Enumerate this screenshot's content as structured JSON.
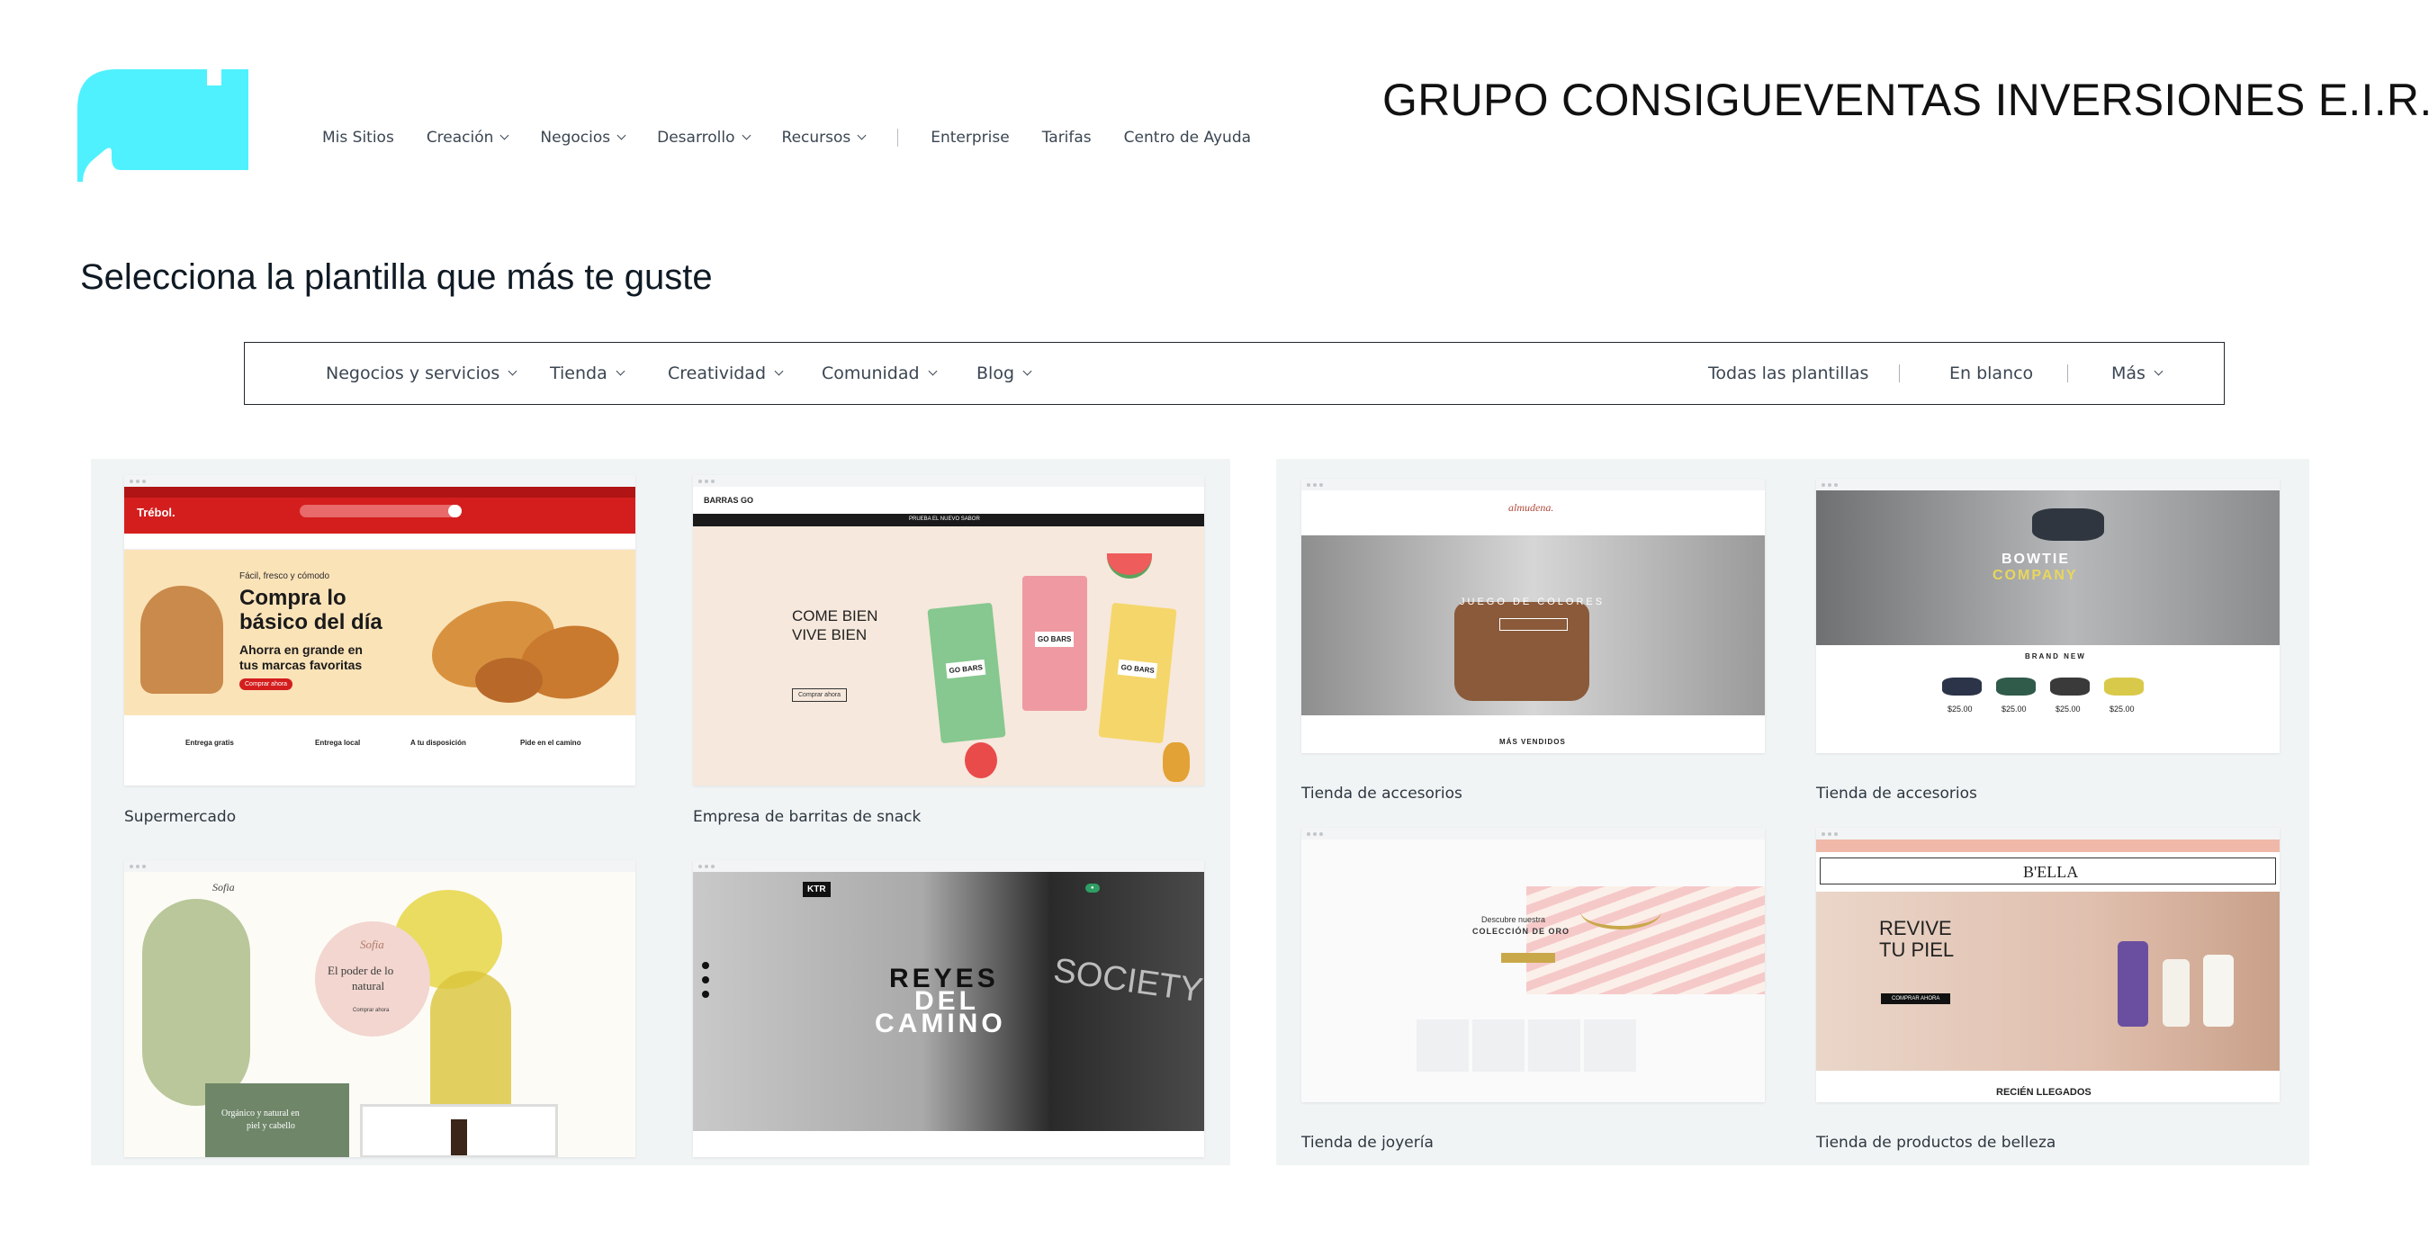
{
  "brand": {
    "company_name": "GRUPO CONSIGUEVENTAS INVERSIONES E.I.R.L.",
    "logo_color": "#4ff1ff"
  },
  "nav": {
    "items": [
      {
        "label": "Mis Sitios",
        "dropdown": false
      },
      {
        "label": "Creación",
        "dropdown": true
      },
      {
        "label": "Negocios",
        "dropdown": true
      },
      {
        "label": "Desarrollo",
        "dropdown": true
      },
      {
        "label": "Recursos",
        "dropdown": true
      }
    ],
    "secondary": [
      {
        "label": "Enterprise"
      },
      {
        "label": "Tarifas"
      },
      {
        "label": "Centro de Ayuda"
      }
    ]
  },
  "page_title": "Selecciona la plantilla que más te guste",
  "categories": {
    "left": [
      {
        "label": "Negocios y servicios"
      },
      {
        "label": "Tienda"
      },
      {
        "label": "Creatividad"
      },
      {
        "label": "Comunidad"
      },
      {
        "label": "Blog"
      }
    ],
    "right": [
      {
        "label": "Todas las plantillas"
      },
      {
        "label": "En blanco"
      },
      {
        "label": "Más"
      }
    ]
  },
  "templates": {
    "left": [
      {
        "label": "Supermercado"
      },
      {
        "label": "Empresa de barritas de snack"
      },
      {
        "label": ""
      },
      {
        "label": ""
      }
    ],
    "right": [
      {
        "label": "Tienda de accesorios"
      },
      {
        "label": "Tienda de accesorios"
      },
      {
        "label": "Tienda de joyería"
      },
      {
        "label": "Tienda de productos de belleza"
      }
    ]
  },
  "previews": {
    "trebol": {
      "store": "Trébol.",
      "headline_small": "Fácil, fresco y cómodo",
      "headline_1": "Compra lo",
      "headline_2": "básico del día",
      "sub_1": "Ahorra en grande en",
      "sub_2": "tus marcas favoritas",
      "cta": "Comprar ahora",
      "features": [
        "Entrega gratis",
        "Entrega local",
        "A tu disposición",
        "Pide en el camino"
      ]
    },
    "barras": {
      "brand": "BARRAS GO",
      "banner": "PRUEBA EL NUEVO SABOR",
      "headline_1": "COME BIEN",
      "headline_2": "VIVE BIEN",
      "cta": "Comprar ahora",
      "pack": "GO BARS"
    },
    "sofia": {
      "brand": "Sofia",
      "tagline_1": "El poder de lo",
      "tagline_2": "natural",
      "cta": "Comprar ahora",
      "box_1": "Orgánico y natural en",
      "box_2": "piel y cabello"
    },
    "reyes": {
      "brand": "KTR",
      "headline_1": "REYES",
      "headline_2": "DEL",
      "headline_3": "CAMINO",
      "shirt": "SOCIETY"
    },
    "almudena": {
      "brand": "almudena.",
      "headline": "JUEGO DE COLORES",
      "section": "MÁS VENDIDOS"
    },
    "bowtie": {
      "headline_1": "BOWTIE",
      "headline_2": "COMPANY",
      "section": "BRAND NEW",
      "price": "$25.00"
    },
    "joyeria": {
      "headline_1": "Descubre nuestra",
      "headline_2": "COLECCIÓN DE ORO"
    },
    "bella": {
      "brand": "B'ELLA",
      "headline_1": "REVIVE",
      "headline_2": "TU PIEL",
      "cta": "COMPRAR AHORA",
      "section": "RECIÉN LLEGADOS"
    }
  }
}
